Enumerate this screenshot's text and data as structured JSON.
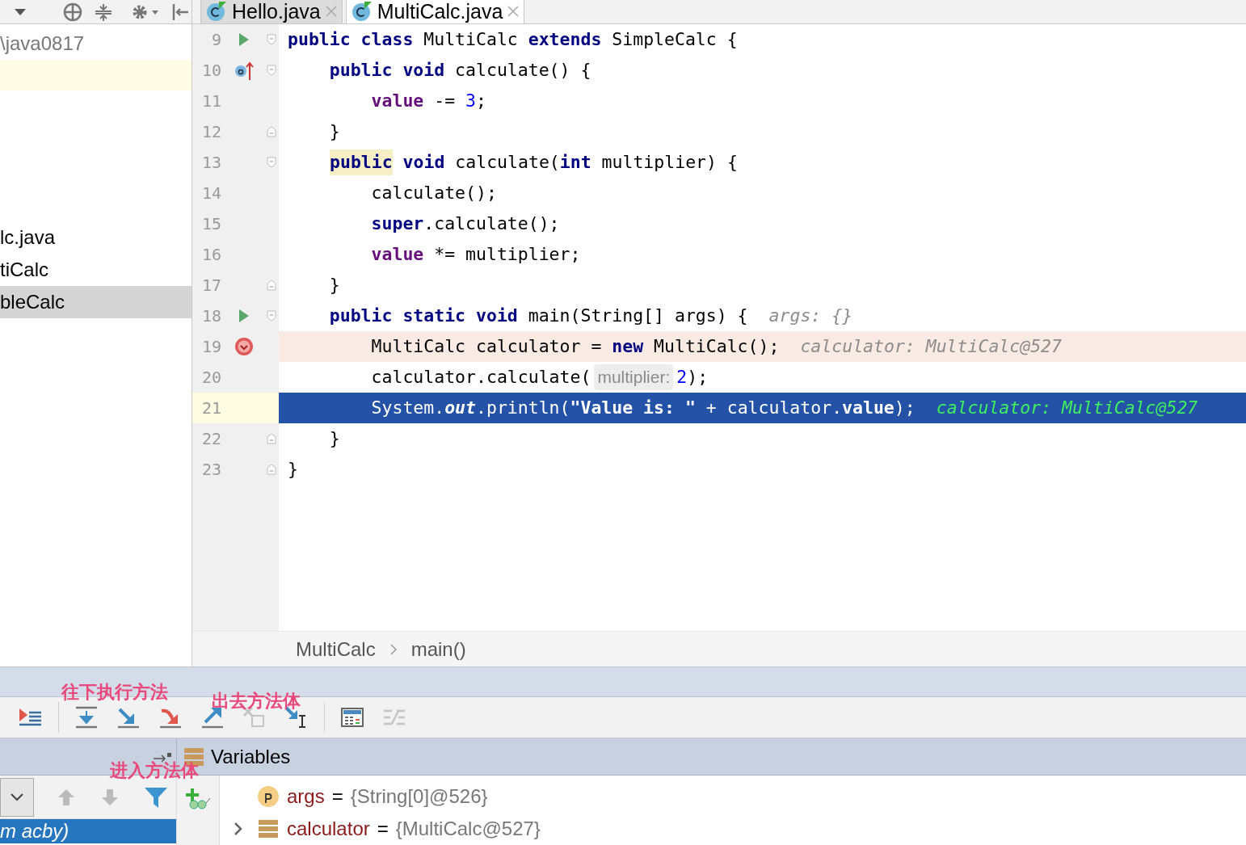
{
  "project_tree": {
    "items": [
      {
        "text": "\\java0817",
        "selected": false
      },
      {
        "text": "lc.java",
        "selected": false
      },
      {
        "text": "tiCalc",
        "selected": false
      },
      {
        "text": "bleCalc",
        "selected": true
      }
    ]
  },
  "editor_tabs": [
    {
      "label": "Hello.java",
      "selected": false
    },
    {
      "label": "MultiCalc.java",
      "selected": true
    }
  ],
  "code_lines": [
    {
      "number": "9",
      "gutter_icon": {
        "kind": "run"
      },
      "fold": {
        "kind": "open"
      },
      "breakpoint": false,
      "current": false,
      "tokens": [
        {
          "kind": "keyword",
          "text": "public class "
        },
        {
          "kind": "text",
          "text": "MultiCalc "
        },
        {
          "kind": "keyword",
          "text": "extends "
        },
        {
          "kind": "text",
          "text": "SimpleCalc {"
        }
      ]
    },
    {
      "number": "10",
      "gutter_icon": {
        "kind": "override"
      },
      "fold": {
        "kind": "open"
      },
      "breakpoint": false,
      "current": false,
      "tokens": [
        {
          "kind": "keyword",
          "text": "    public void "
        },
        {
          "kind": "text",
          "text": "calculate() {"
        }
      ]
    },
    {
      "number": "11",
      "breakpoint": false,
      "current": false,
      "tokens": [
        {
          "kind": "field",
          "text": "        value"
        },
        {
          "kind": "text",
          "text": " -= "
        },
        {
          "kind": "number",
          "text": "3"
        },
        {
          "kind": "text",
          "text": ";"
        }
      ]
    },
    {
      "number": "12",
      "fold": {
        "kind": "close"
      },
      "breakpoint": false,
      "current": false,
      "tokens": [
        {
          "kind": "text",
          "text": "    }"
        }
      ]
    },
    {
      "number": "13",
      "fold": {
        "kind": "open"
      },
      "breakpoint": false,
      "current": false,
      "tokens": [
        {
          "kind": "keyword_marked",
          "text": "public"
        },
        {
          "kind": "keyword",
          "text": " void "
        },
        {
          "kind": "text",
          "text": "calculate("
        },
        {
          "kind": "keyword",
          "text": "int"
        },
        {
          "kind": "text",
          "text": " multiplier) {"
        }
      ]
    },
    {
      "number": "14",
      "breakpoint": false,
      "current": false,
      "tokens": [
        {
          "kind": "text",
          "text": "        calculate();"
        }
      ]
    },
    {
      "number": "15",
      "breakpoint": false,
      "current": false,
      "tokens": [
        {
          "kind": "keyword",
          "text": "        super"
        },
        {
          "kind": "text",
          "text": ".calculate();"
        }
      ]
    },
    {
      "number": "16",
      "breakpoint": false,
      "current": false,
      "tokens": [
        {
          "kind": "field",
          "text": "        value"
        },
        {
          "kind": "text",
          "text": " *= multiplier;"
        }
      ]
    },
    {
      "number": "17",
      "fold": {
        "kind": "close"
      },
      "breakpoint": false,
      "current": false,
      "tokens": [
        {
          "kind": "text",
          "text": "    }"
        }
      ]
    },
    {
      "number": "18",
      "gutter_icon": {
        "kind": "run"
      },
      "fold": {
        "kind": "open"
      },
      "breakpoint": false,
      "current": false,
      "tokens": [
        {
          "kind": "keyword",
          "text": "    public static void "
        },
        {
          "kind": "text",
          "text": "main(String[] args) {"
        }
      ],
      "inline_value": "args: {}"
    },
    {
      "number": "19",
      "breakpoint": true,
      "current": false,
      "tokens": [
        {
          "kind": "text",
          "text": "        MultiCalc calculator = "
        },
        {
          "kind": "keyword",
          "text": "new"
        },
        {
          "kind": "text",
          "text": " MultiCalc();"
        }
      ],
      "inline_value": "calculator: MultiCalc@527"
    },
    {
      "number": "20",
      "breakpoint": false,
      "current": false,
      "tokens": [
        {
          "kind": "text",
          "text": "        calculator.calculate("
        },
        {
          "kind": "param_hint",
          "text": "multiplier:"
        },
        {
          "kind": "number",
          "text": "2"
        },
        {
          "kind": "text",
          "text": ");"
        }
      ]
    },
    {
      "number": "21",
      "breakpoint": false,
      "current": true,
      "tokens": [
        {
          "kind": "text",
          "text": "        System."
        },
        {
          "kind": "static_field",
          "text": "out"
        },
        {
          "kind": "text",
          "text": ".println("
        },
        {
          "kind": "string",
          "text": "\"Value is: \""
        },
        {
          "kind": "text",
          "text": " + calculator."
        },
        {
          "kind": "field",
          "text": "value"
        },
        {
          "kind": "text",
          "text": ");"
        }
      ],
      "inline_value": "calculator: MultiCalc@527"
    },
    {
      "number": "22",
      "fold": {
        "kind": "close"
      },
      "breakpoint": false,
      "current": false,
      "tokens": [
        {
          "kind": "text",
          "text": "    }"
        }
      ]
    },
    {
      "number": "23",
      "fold": {
        "kind": "close"
      },
      "breakpoint": false,
      "current": false,
      "tokens": [
        {
          "kind": "text",
          "text": "}"
        }
      ]
    }
  ],
  "breadcrumb": [
    "MultiCalc",
    "main()"
  ],
  "debug_toolbar": [
    {
      "kind": "show_execution_point",
      "disabled": false
    },
    {
      "kind": "step_over",
      "disabled": false
    },
    {
      "kind": "step_into",
      "disabled": false
    },
    {
      "kind": "force_step_into",
      "disabled": false
    },
    {
      "kind": "step_out",
      "disabled": false
    },
    {
      "kind": "drop_frame",
      "disabled": true
    },
    {
      "kind": "run_to_cursor",
      "disabled": false
    },
    {
      "kind": "evaluate",
      "disabled": false
    },
    {
      "kind": "trace",
      "disabled": true
    }
  ],
  "annotations": [
    {
      "text": "往下执行方法"
    },
    {
      "text": "出去方法体"
    },
    {
      "text": "进入方法体"
    }
  ],
  "variables_panel": {
    "title": "Variables"
  },
  "frames": [
    {
      "text": "m acby)",
      "selected": true
    }
  ],
  "variables": [
    {
      "kind": "param",
      "name": "args",
      "operator": "=",
      "value": "{String[0]@526}",
      "expandable": false
    },
    {
      "kind": "object",
      "name": "calculator",
      "operator": "=",
      "value": "{MultiCalc@527}",
      "expandable": true
    }
  ]
}
